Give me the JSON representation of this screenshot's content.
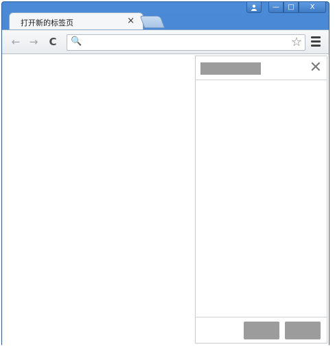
{
  "window": {
    "controls": {
      "user_icon": "user-icon",
      "minimize_label": "—",
      "maximize_label": "□",
      "close_label": "X"
    }
  },
  "tabs": [
    {
      "title": "打开新的标签页",
      "close_label": "×"
    }
  ],
  "toolbar": {
    "back_label": "←",
    "forward_label": "→",
    "reload_label": "C",
    "omnibox": {
      "value": "",
      "placeholder": "",
      "search_icon": "🔍",
      "star_label": "☆"
    },
    "menu_icon": "hamburger-menu-icon"
  },
  "dialog": {
    "close_label": "✕"
  },
  "colors": {
    "frame": "#3b78c8",
    "placeholder_gray": "#9c9c9c"
  }
}
